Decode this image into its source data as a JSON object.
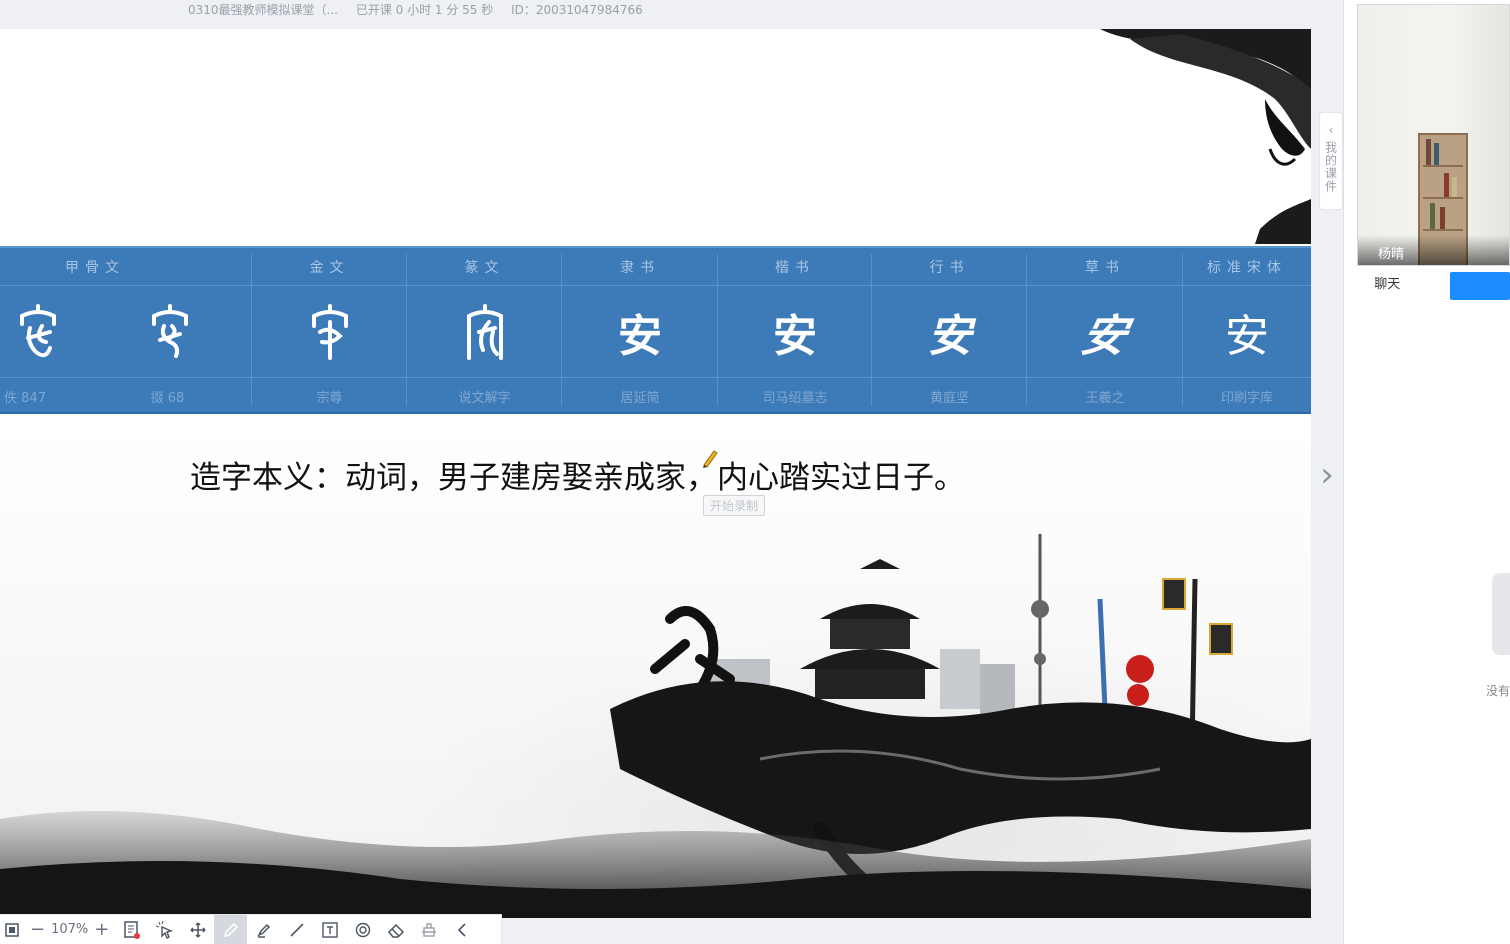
{
  "topbar": {
    "course_title": "0310最强教师模拟课堂（...",
    "elapsed": "已开课 0 小时 1 分 55 秒",
    "id_text": "ID：20031047984766"
  },
  "slide": {
    "script_table": {
      "headers": [
        "甲骨文",
        "金文",
        "篆文",
        "隶书",
        "楷书",
        "行书",
        "草书",
        "标准宋体"
      ],
      "glyphs": [
        "",
        "",
        "",
        "安",
        "安",
        "安",
        "安",
        "安"
      ],
      "sources": [
        "佚 847",
        "掇 68",
        "宗尊",
        "说文解字",
        "居延简",
        "司马绍墓志",
        "黄庭坚",
        "王羲之",
        "印刷字库"
      ]
    },
    "meaning": "造字本义：动词，男子建房娶亲成家，内心踏实过日子。",
    "record_tip": "开始录制"
  },
  "courseware_tab": {
    "label": "我的课件"
  },
  "right_panel": {
    "video_name": "杨晴",
    "tabs": [
      "聊天",
      ""
    ],
    "chat_empty": "没有"
  },
  "toolbar": {
    "zoom_value": "107%",
    "zoom_out": "−",
    "zoom_in": "+"
  },
  "colors": {
    "table_blue": "#3d7ab8",
    "accent_blue": "#1a8cff"
  }
}
